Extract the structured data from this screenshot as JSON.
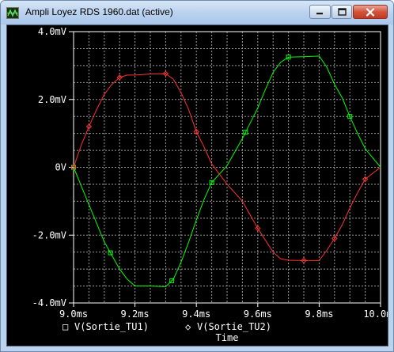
{
  "window": {
    "title": "Ampli Loyez RDS 1960.dat (active)",
    "controls": {
      "minimize": "minimize-icon",
      "maximize": "maximize-icon",
      "close": "close-icon"
    }
  },
  "plot": {
    "x_axis_label": "Time",
    "legend": [
      {
        "marker": "□",
        "label": "V(Sortie_TU1)",
        "color": "#00ff00"
      },
      {
        "marker": "◇",
        "label": "V(Sortie_TU2)",
        "color": "#ff3030"
      }
    ],
    "colors": {
      "background": "#000000",
      "grid": "#9a9a9a",
      "axes": "#ffffff"
    }
  },
  "chart_data": {
    "type": "line",
    "xlabel": "Time",
    "ylabel": "",
    "xlim": [
      9.0,
      10.0
    ],
    "ylim": [
      -4.0,
      4.0
    ],
    "x_unit": "ms",
    "y_unit": "mV",
    "x_ticks": [
      "9.0ms",
      "9.2ms",
      "9.4ms",
      "9.6ms",
      "9.8ms",
      "10.0ms"
    ],
    "y_ticks": [
      "4.0mV",
      "2.0mV",
      "0V",
      "-2.0mV",
      "-4.0mV"
    ],
    "x_tick_values": [
      9.0,
      9.2,
      9.4,
      9.6,
      9.8,
      10.0
    ],
    "y_tick_values": [
      4.0,
      2.0,
      0.0,
      -2.0,
      -4.0
    ],
    "grid": true,
    "legend_position": "bottom",
    "series": [
      {
        "name": "V(Sortie_TU1)",
        "color": "#00ff00",
        "x": [
          9.0,
          9.025,
          9.05,
          9.075,
          9.1,
          9.125,
          9.15,
          9.175,
          9.2,
          9.25,
          9.3,
          9.325,
          9.35,
          9.375,
          9.4,
          9.425,
          9.45,
          9.5,
          9.55,
          9.575,
          9.6,
          9.625,
          9.65,
          9.675,
          9.7,
          9.75,
          9.8,
          9.825,
          9.85,
          9.875,
          9.9,
          9.925,
          9.95,
          10.0
        ],
        "values": [
          0.0,
          -0.55,
          -1.1,
          -1.65,
          -2.2,
          -2.6,
          -3.0,
          -3.3,
          -3.5,
          -3.5,
          -3.52,
          -3.3,
          -2.8,
          -2.2,
          -1.55,
          -0.95,
          -0.45,
          0.05,
          0.85,
          1.3,
          1.75,
          2.3,
          2.8,
          3.1,
          3.25,
          3.26,
          3.28,
          2.95,
          2.45,
          2.05,
          1.5,
          1.0,
          0.55,
          0.0
        ],
        "markers_at": [
          9.0,
          9.12,
          9.32,
          9.45,
          9.56,
          9.7,
          9.9
        ]
      },
      {
        "name": "V(Sortie_TU2)",
        "color": "#ff3030",
        "x": [
          9.0,
          9.025,
          9.05,
          9.075,
          9.1,
          9.125,
          9.15,
          9.175,
          9.2,
          9.25,
          9.3,
          9.325,
          9.35,
          9.375,
          9.4,
          9.425,
          9.45,
          9.5,
          9.55,
          9.575,
          9.6,
          9.625,
          9.65,
          9.675,
          9.7,
          9.75,
          9.8,
          9.825,
          9.85,
          9.875,
          9.9,
          9.925,
          9.95,
          10.0
        ],
        "values": [
          0.0,
          0.65,
          1.2,
          1.7,
          2.15,
          2.45,
          2.65,
          2.72,
          2.72,
          2.75,
          2.76,
          2.6,
          2.2,
          1.7,
          1.05,
          0.6,
          0.1,
          -0.5,
          -1.0,
          -1.4,
          -1.8,
          -2.15,
          -2.5,
          -2.7,
          -2.74,
          -2.75,
          -2.75,
          -2.45,
          -2.1,
          -1.7,
          -1.2,
          -0.75,
          -0.35,
          0.0
        ],
        "markers_at": [
          9.0,
          9.05,
          9.15,
          9.3,
          9.4,
          9.6,
          9.75,
          9.85,
          9.95
        ]
      }
    ]
  }
}
